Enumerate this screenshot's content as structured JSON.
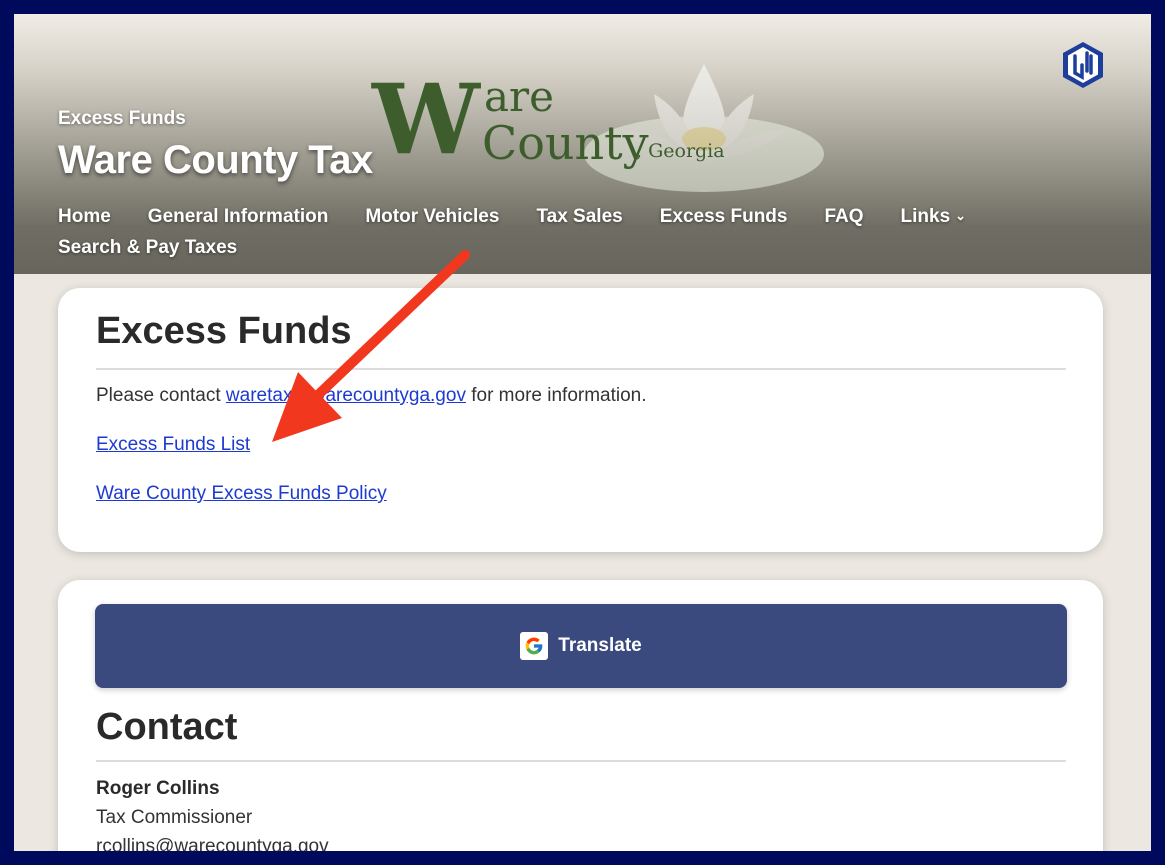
{
  "header": {
    "logo": {
      "word_w": "W",
      "word_are": "are",
      "word_county": "County",
      "word_georgia": ", Georgia"
    },
    "breadcrumb": "Excess Funds",
    "site_title": "Ware County Tax",
    "nav": [
      {
        "label": "Home"
      },
      {
        "label": "General Information"
      },
      {
        "label": "Motor Vehicles"
      },
      {
        "label": "Tax Sales"
      },
      {
        "label": "Excess Funds"
      },
      {
        "label": "FAQ"
      },
      {
        "label": "Links",
        "has_dropdown": true
      },
      {
        "label": "Search & Pay Taxes"
      }
    ]
  },
  "excess_funds": {
    "heading": "Excess Funds",
    "contact_prefix": "Please contact ",
    "contact_email": "waretax@warecountyga.gov",
    "contact_suffix": " for more information.",
    "link_list": "Excess Funds List",
    "link_policy": "Ware County Excess Funds Policy"
  },
  "translate": {
    "label": "Translate",
    "icon": "google-g-icon"
  },
  "contact": {
    "heading": "Contact",
    "name": "Roger Collins",
    "title": "Tax Commissioner",
    "email": "rcollins@warecountyga.gov"
  },
  "colors": {
    "frame_border": "#000a5c",
    "page_background": "#ece8e1",
    "link": "#1c3ad1",
    "translate_button": "#3a4a7f",
    "annotation_arrow": "#f2371f",
    "logo_green": "#3d5e2c"
  },
  "icons": {
    "site_badge": "hexagon-badge-icon",
    "dropdown": "chevron-down-icon",
    "annotation": "red-arrow-icon"
  }
}
